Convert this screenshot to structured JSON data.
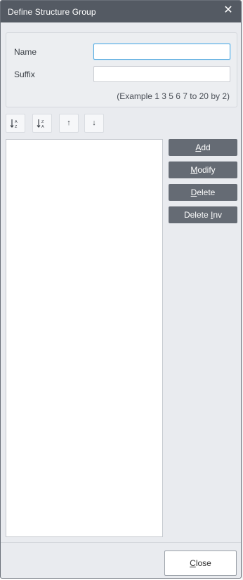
{
  "window": {
    "title": "Define Structure Group",
    "close_glyph": "✕"
  },
  "form": {
    "name_label": "Name",
    "name_value": "",
    "suffix_label": "Suffix",
    "suffix_value": "",
    "hint": "(Example 1 3 5 6 7 to 20 by 2)"
  },
  "toolbar": {
    "sort_asc_text": "A↓Z",
    "sort_desc_text": "Z↓A",
    "move_up_glyph": "↑",
    "move_down_glyph": "↓"
  },
  "list": {
    "items": []
  },
  "actions": {
    "add": {
      "mnemonic": "A",
      "rest": "dd"
    },
    "modify": {
      "mnemonic": "M",
      "rest": "odify"
    },
    "delete": {
      "mnemonic": "D",
      "rest": "elete"
    },
    "delete_inv": {
      "pre": "Delete ",
      "mnemonic": "I",
      "rest": "nv"
    }
  },
  "footer": {
    "close": {
      "mnemonic": "C",
      "rest": "lose"
    }
  },
  "colors": {
    "titlebar": "#545a63",
    "dialog_bg": "#e9ebef",
    "action_button": "#656b74",
    "focus_border": "#57a9de"
  }
}
